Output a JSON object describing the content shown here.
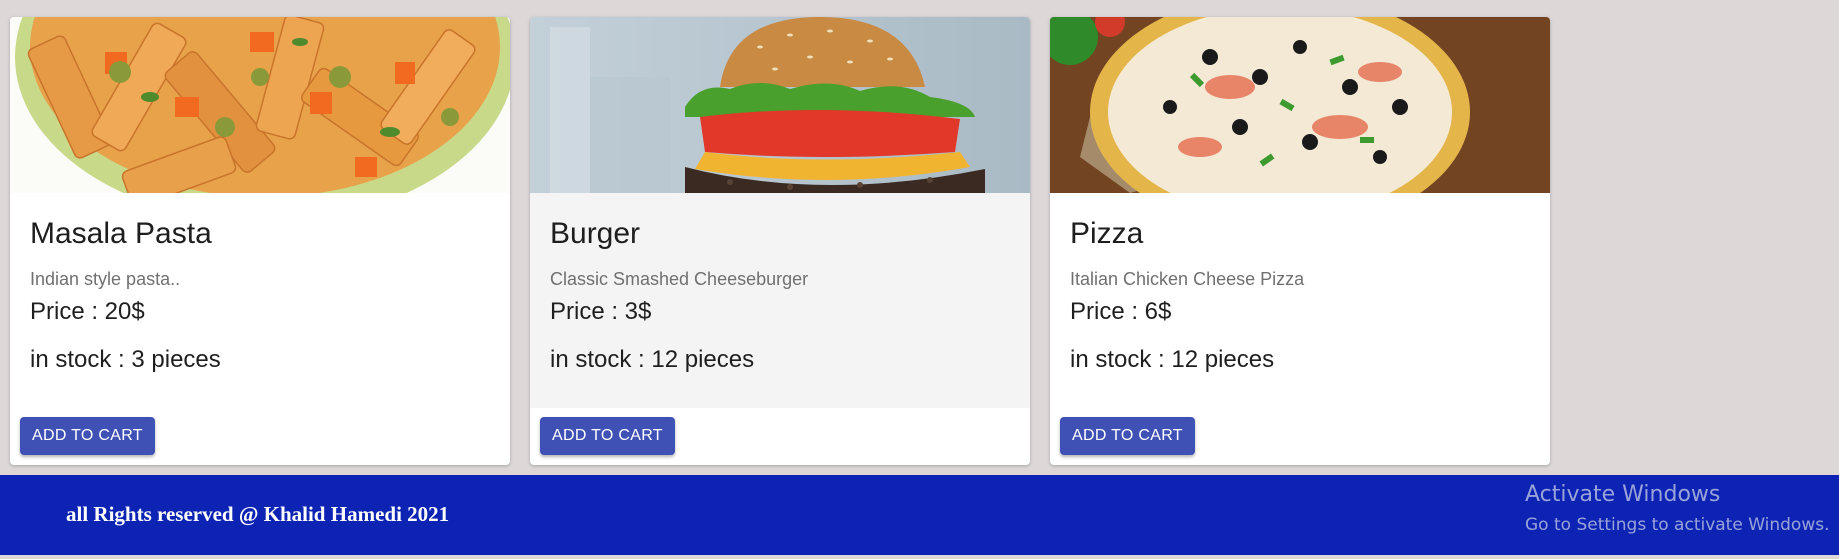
{
  "products": [
    {
      "title": "Masala Pasta",
      "description": "Indian style pasta..",
      "price": "Price : 20$",
      "stock": "in stock : 3 pieces",
      "button": "ADD TO CART",
      "image_icon": "pasta-image"
    },
    {
      "title": "Burger",
      "description": "Classic Smashed Cheeseburger",
      "price": "Price : 3$",
      "stock": "in stock : 12 pieces",
      "button": "ADD TO CART",
      "image_icon": "burger-image"
    },
    {
      "title": "Pizza",
      "description": "Italian Chicken Cheese Pizza",
      "price": "Price : 6$",
      "stock": "in stock : 12 pieces",
      "button": "ADD TO CART",
      "image_icon": "pizza-image"
    }
  ],
  "footer": {
    "text": "all Rights reserved @ Khalid Hamedi 2021"
  },
  "watermark": {
    "title": "Activate Windows",
    "subtitle": "Go to Settings to activate Windows."
  },
  "colors": {
    "page_bg": "#ddd7d8",
    "button_bg": "#3f51b5",
    "footer_bg": "#0c23b3"
  }
}
